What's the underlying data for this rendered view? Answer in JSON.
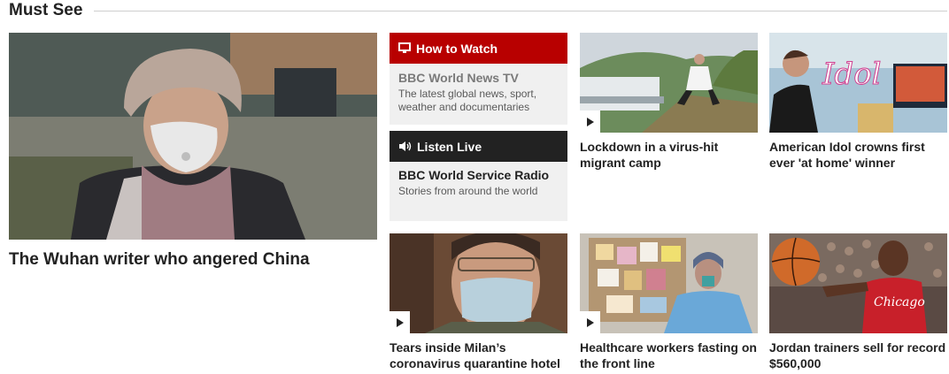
{
  "section": {
    "title": "Must See"
  },
  "featured": {
    "headline": "The Wuhan writer who angered China"
  },
  "watch_panel": {
    "header": "How to Watch",
    "title": "BBC World News TV",
    "description": "The latest global news, sport, weather and documentaries",
    "accent": "#b80000"
  },
  "listen_panel": {
    "header": "Listen Live",
    "title": "BBC World Service Radio",
    "description": "Stories from around the world",
    "accent": "#222222"
  },
  "cards": [
    {
      "headline": "Lockdown in a virus-hit migrant camp",
      "has_video": true
    },
    {
      "headline": "American Idol crowns first ever 'at home' winner",
      "has_video": false
    },
    {
      "headline": "Tears inside Milan’s coronavirus quarantine hotel",
      "has_video": true
    },
    {
      "headline": "Healthcare workers fasting on the front line",
      "has_video": true
    },
    {
      "headline": "Jordan trainers sell for record $560,000",
      "has_video": false
    }
  ]
}
